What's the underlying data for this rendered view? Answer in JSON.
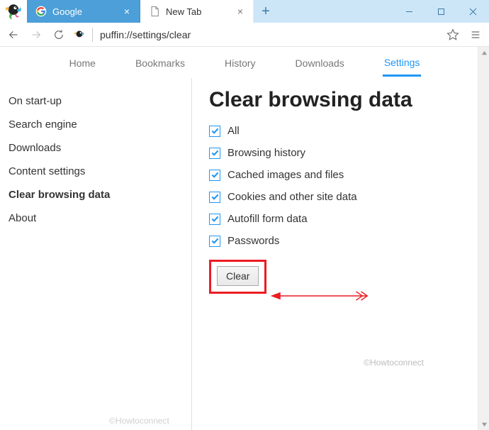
{
  "window": {
    "tabs": [
      {
        "title": "Google",
        "active": false
      },
      {
        "title": "New Tab",
        "active": true
      }
    ]
  },
  "address": {
    "url": "puffin://settings/clear"
  },
  "topnav": {
    "items": [
      {
        "label": "Home"
      },
      {
        "label": "Bookmarks"
      },
      {
        "label": "History"
      },
      {
        "label": "Downloads"
      },
      {
        "label": "Settings",
        "active": true
      }
    ]
  },
  "sidebar": {
    "items": [
      {
        "label": "On start-up"
      },
      {
        "label": "Search engine"
      },
      {
        "label": "Downloads"
      },
      {
        "label": "Content settings"
      },
      {
        "label": "Clear browsing data",
        "active": true
      },
      {
        "label": "About"
      }
    ]
  },
  "main": {
    "heading": "Clear browsing data",
    "checkboxes": [
      {
        "label": "All",
        "checked": true
      },
      {
        "label": "Browsing history",
        "checked": true
      },
      {
        "label": "Cached images and files",
        "checked": true
      },
      {
        "label": "Cookies and other site data",
        "checked": true
      },
      {
        "label": "Autofill form data",
        "checked": true
      },
      {
        "label": "Passwords",
        "checked": true
      }
    ],
    "clear_label": "Clear"
  },
  "watermark": {
    "text": "©Howtoconnect",
    "text2": "©Howtoconnect"
  },
  "colors": {
    "accent": "#2196f3",
    "annotation": "#ec1c24",
    "tab_inactive": "#4c9fd8"
  }
}
